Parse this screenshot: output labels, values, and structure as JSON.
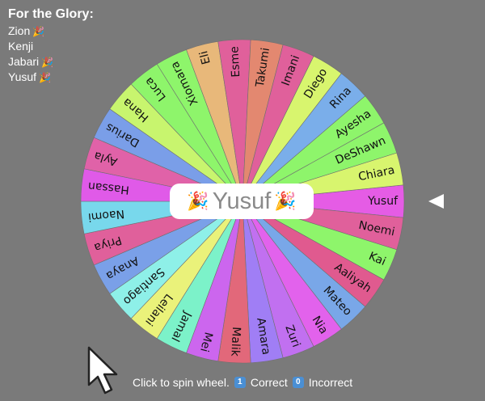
{
  "roster": {
    "title": "For the Glory:",
    "items": [
      {
        "name": "Zion",
        "tag": "🎉"
      },
      {
        "name": "Kenji",
        "tag": ""
      },
      {
        "name": "Jabari",
        "tag": "🎉"
      },
      {
        "name": "Yusuf",
        "tag": "🎉"
      }
    ]
  },
  "wheel": {
    "segments": [
      {
        "name": "Yusuf",
        "color": "#e55ce5"
      },
      {
        "name": "Noemi",
        "color": "#e0609b"
      },
      {
        "name": "Kai",
        "color": "#8ef56b"
      },
      {
        "name": "Aaliyah",
        "color": "#e05a8f"
      },
      {
        "name": "Mateo",
        "color": "#79a7e8"
      },
      {
        "name": "Nia",
        "color": "#e262ec"
      },
      {
        "name": "Zuri",
        "color": "#c170f0"
      },
      {
        "name": "Amara",
        "color": "#a07ef5"
      },
      {
        "name": "Malik",
        "color": "#e2687a"
      },
      {
        "name": "Mei",
        "color": "#cc66ee"
      },
      {
        "name": "Jamal",
        "color": "#7cf2c9"
      },
      {
        "name": "Leilani",
        "color": "#eaf27a"
      },
      {
        "name": "Santiago",
        "color": "#8ef0e8"
      },
      {
        "name": "Anaya",
        "color": "#7aa0e8"
      },
      {
        "name": "Priya",
        "color": "#e0609b"
      },
      {
        "name": "Naomi",
        "color": "#78d8ec"
      },
      {
        "name": "Hassan",
        "color": "#e05ae8"
      },
      {
        "name": "Ayla",
        "color": "#e062a8"
      },
      {
        "name": "Darius",
        "color": "#7a9ee8"
      },
      {
        "name": "Hana",
        "color": "#c8f56e"
      },
      {
        "name": "Luca",
        "color": "#8ef56b"
      },
      {
        "name": "Xiomara",
        "color": "#8ef56b"
      },
      {
        "name": "Eli",
        "color": "#e8b87a"
      },
      {
        "name": "Esme",
        "color": "#e0609b"
      },
      {
        "name": "Takumi",
        "color": "#e38870"
      },
      {
        "name": "Imani",
        "color": "#e0609b"
      },
      {
        "name": "Diego",
        "color": "#d8f56e"
      },
      {
        "name": "Rina",
        "color": "#7aaeea"
      },
      {
        "name": "Ayesha",
        "color": "#8ef56b"
      },
      {
        "name": "DeShawn",
        "color": "#8ef56b"
      },
      {
        "name": "Chiara",
        "color": "#d8f56e"
      }
    ]
  },
  "winner": {
    "emoji": "🎉",
    "name": "Yusuf"
  },
  "footer": {
    "prefix": "Click to spin wheel.",
    "key1": "1",
    "correct_label": "Correct",
    "key0": "0",
    "incorrect_label": "Incorrect"
  }
}
